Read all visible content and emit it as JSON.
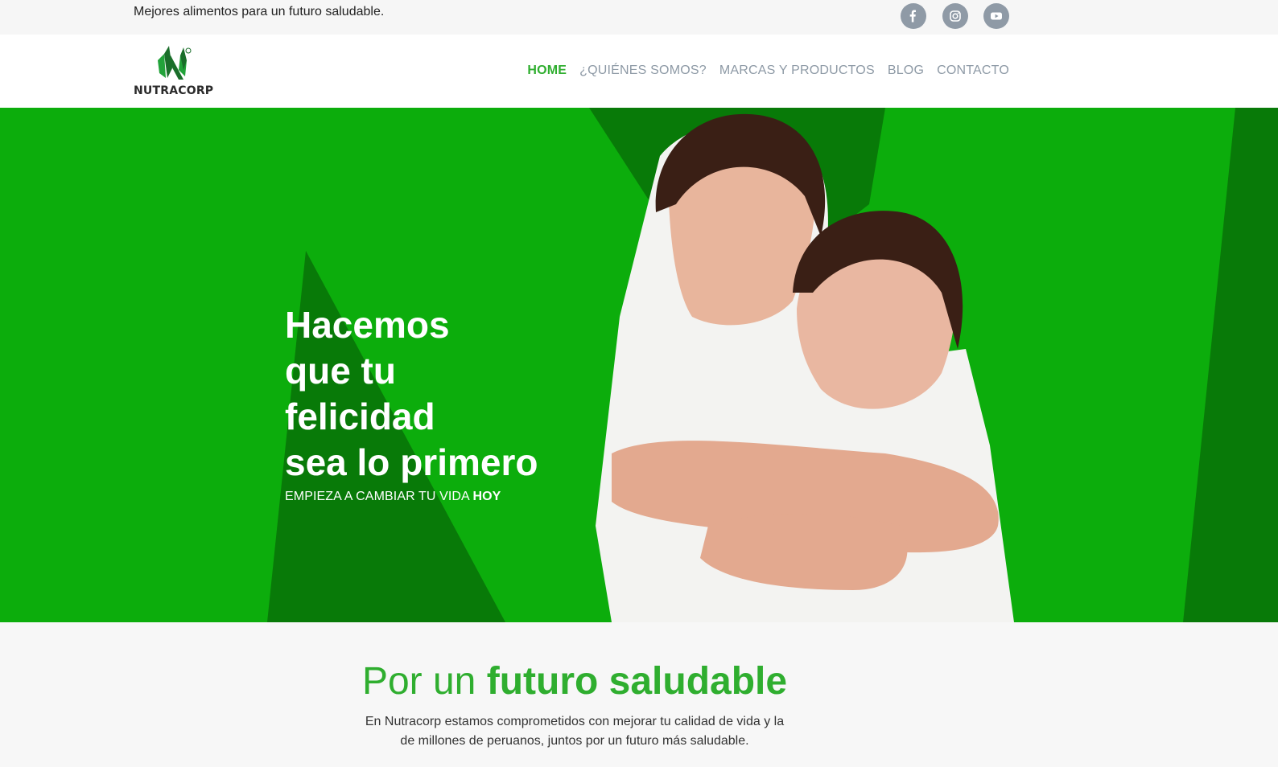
{
  "topbar": {
    "tagline": "Mejores alimentos para un futuro saludable.",
    "social": [
      "facebook-icon",
      "instagram-icon",
      "youtube-icon"
    ]
  },
  "header": {
    "logo_text": "NUTRACORP",
    "nav": [
      {
        "label": "HOME",
        "active": true
      },
      {
        "label": "¿QUIÉNES SOMOS?",
        "active": false
      },
      {
        "label": "MARCAS Y PRODUCTOS",
        "active": false
      },
      {
        "label": "BLOG",
        "active": false
      },
      {
        "label": "CONTACTO",
        "active": false
      }
    ]
  },
  "hero": {
    "title_lines": [
      "Hacemos",
      "que tu",
      "felicidad",
      "sea lo primero"
    ],
    "subtitle_prefix": "EMPIEZA A CAMBIAR TU VIDA ",
    "subtitle_bold": "HOY"
  },
  "section": {
    "title_prefix": "Por un ",
    "title_bold": "futuro saludable",
    "text": "En Nutracorp estamos comprometidos con mejorar tu calidad de vida y la de millones de peruanos, juntos por un futuro más saludable."
  },
  "colors": {
    "brand_green": "#2fae2f",
    "hero_green": "#0cad0c",
    "hero_dark_green": "#087a08",
    "nav_gray": "#8d99a5"
  }
}
